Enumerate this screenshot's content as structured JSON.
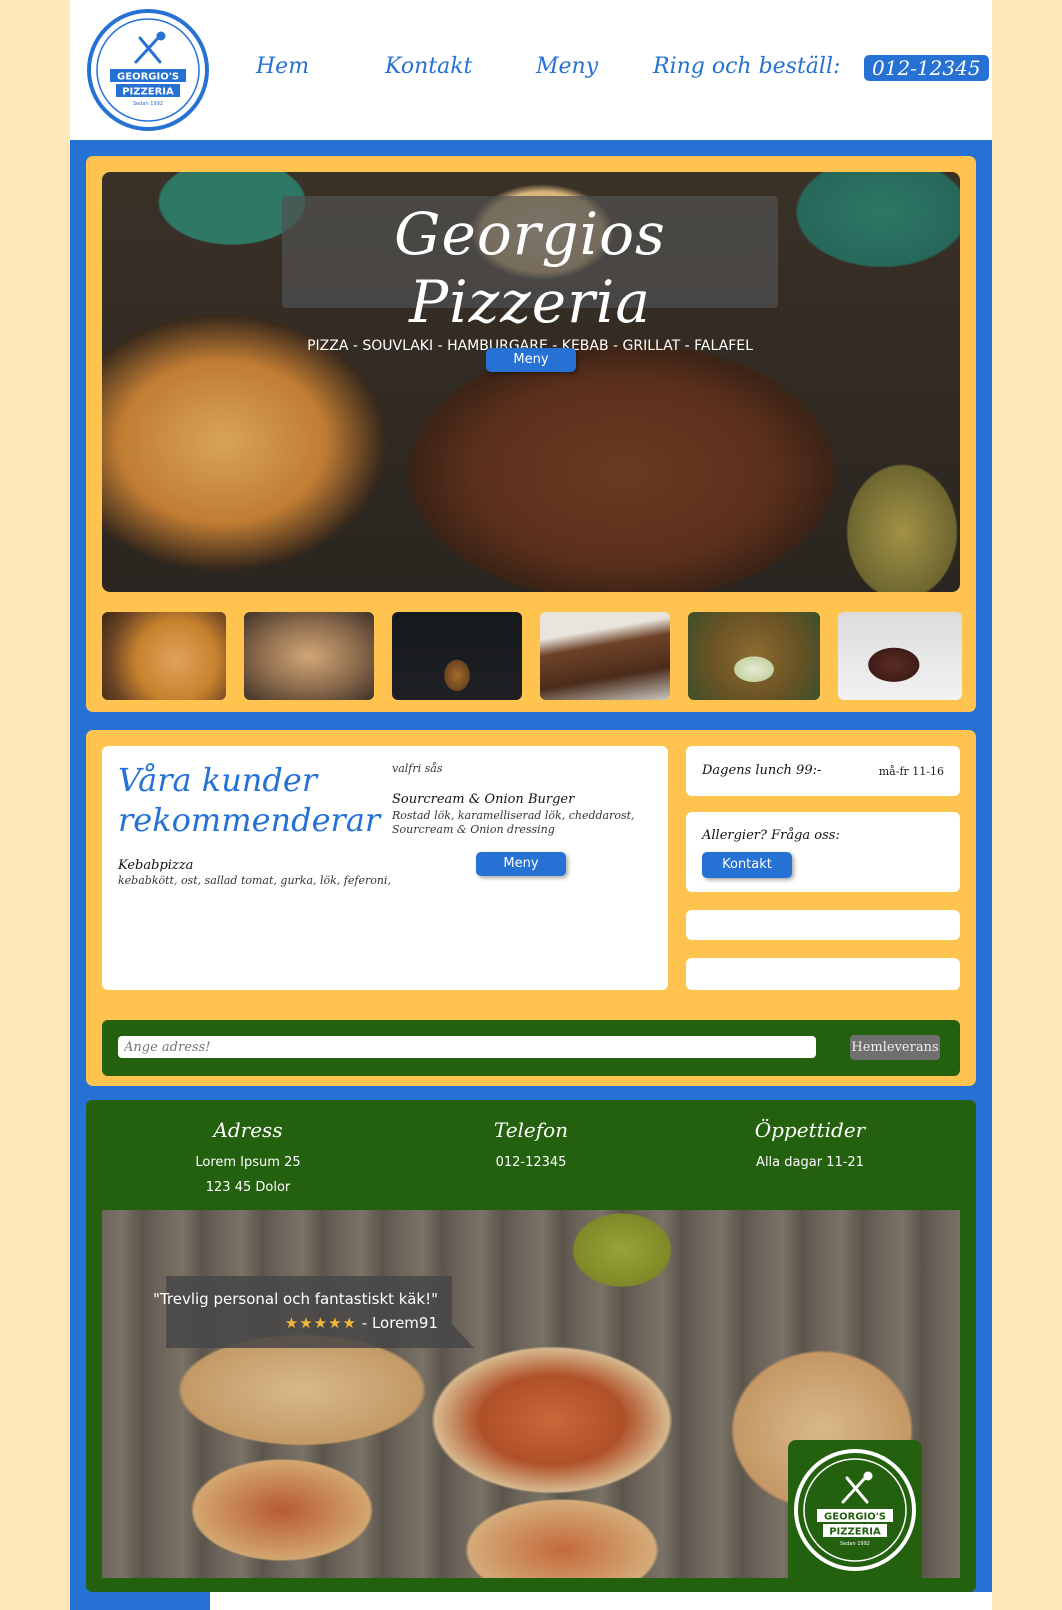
{
  "header": {
    "logo_top": "GEORGIO'S",
    "logo_bottom": "PIZZERIA",
    "logo_since": "Sedan 1992",
    "nav": [
      "Hem",
      "Kontakt",
      "Meny",
      "Ring och beställ:"
    ],
    "phone": "012-12345"
  },
  "hero": {
    "title": "Georgios Pizzeria",
    "subtitle": "PIZZA - SOUVLAKI - HAMBURGARE - KEBAB - GRILLAT - FALAFEL",
    "menu_button": "Meny"
  },
  "recommend": {
    "title_line1": "Våra kunder",
    "title_line2": "rekommenderar",
    "item1_name": "Kebabpizza",
    "item1_desc": "kebabkött, ost, sallad tomat, gurka, lök, feferoni,",
    "item1_extra": "valfri sås",
    "item2_name": "Sourcream & Onion Burger",
    "item2_desc_line1": "Rostad lök, karamelliserad lök, cheddarost,",
    "item2_desc_line2": "Sourcream & Onion dressing",
    "menu_button": "Meny"
  },
  "sidebar": {
    "lunch": "Dagens lunch 99:-",
    "lunch_time": "må-fr 11-16",
    "allergy": "Allergier? Fråga oss:",
    "contact_button": "Kontakt"
  },
  "delivery": {
    "placeholder": "Ange adress!",
    "button": "Hemleverans"
  },
  "footer": {
    "address_head": "Adress",
    "address_line1": "Lorem Ipsum 25",
    "address_line2": "123 45 Dolor",
    "phone_head": "Telefon",
    "phone": "012-12345",
    "hours_head": "Öppettider",
    "hours": "Alla dagar 11-21"
  },
  "review": {
    "quote": "\"Trevlig personal och fantastiskt käk!\"",
    "stars": "★★★★★",
    "author": "- Lorem91"
  },
  "colors": {
    "blue": "#2671d4",
    "yellow": "#fec44f",
    "green": "#23610f",
    "cream": "#ffe8b8"
  }
}
